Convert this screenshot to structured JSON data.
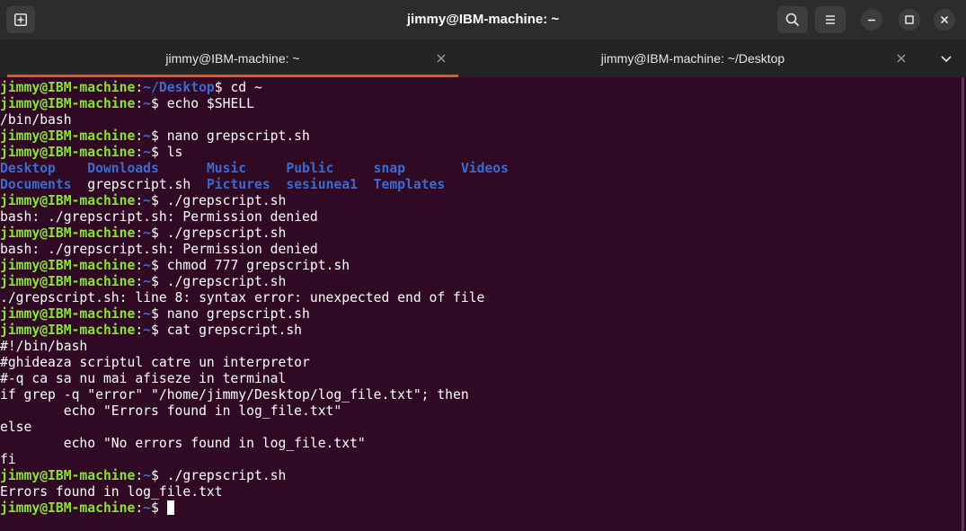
{
  "window": {
    "title": "jimmy@IBM-machine: ~"
  },
  "tabs": [
    {
      "label": "jimmy@IBM-machine: ~",
      "active": true
    },
    {
      "label": "jimmy@IBM-machine: ~/Desktop",
      "active": false
    }
  ],
  "icons": {
    "new_tab": "new-tab-icon",
    "search": "search-icon",
    "menu": "hamburger-menu-icon",
    "minimize": "minimize-icon",
    "maximize": "maximize-icon",
    "close": "close-icon",
    "tab_close": "close-icon",
    "tabs_dropdown": "chevron-down-icon"
  },
  "colors": {
    "terminal_bg": "#300a24",
    "prompt_user": "#8ae234",
    "prompt_path": "#3b6bd1",
    "directory": "#3b6bd1",
    "text": "#ffffff",
    "active_tab_underline": "#e95420"
  },
  "prompt": {
    "user_host": "jimmy@IBM-machine",
    "separator": ":",
    "suffix": "$ "
  },
  "terminal": {
    "lines": [
      {
        "type": "prompt",
        "path": "~/Desktop",
        "cmd": "cd ~"
      },
      {
        "type": "prompt",
        "path": "~",
        "cmd": "echo $SHELL"
      },
      {
        "type": "output",
        "text": "/bin/bash"
      },
      {
        "type": "prompt",
        "path": "~",
        "cmd": "nano grepscript.sh"
      },
      {
        "type": "prompt",
        "path": "~",
        "cmd": "ls"
      },
      {
        "type": "ls",
        "cells": [
          {
            "text": "Desktop   ",
            "dir": true
          },
          {
            "text": " ",
            "dir": false
          },
          {
            "text": "Downloads ",
            "dir": true
          },
          {
            "text": "     ",
            "dir": false
          },
          {
            "text": "Music",
            "dir": true
          },
          {
            "text": "     ",
            "dir": false
          },
          {
            "text": "Public",
            "dir": true
          },
          {
            "text": "     ",
            "dir": false
          },
          {
            "text": "snap",
            "dir": true
          },
          {
            "text": "       ",
            "dir": false
          },
          {
            "text": "Videos",
            "dir": true
          }
        ]
      },
      {
        "type": "ls",
        "cells": [
          {
            "text": "Documents",
            "dir": true
          },
          {
            "text": "  ",
            "dir": false
          },
          {
            "text": "grepscript.sh",
            "dir": false
          },
          {
            "text": "  ",
            "dir": false
          },
          {
            "text": "Pictures",
            "dir": true
          },
          {
            "text": "  ",
            "dir": false
          },
          {
            "text": "sesiunea1",
            "dir": true
          },
          {
            "text": "  ",
            "dir": false
          },
          {
            "text": "Templates",
            "dir": true
          }
        ]
      },
      {
        "type": "prompt",
        "path": "~",
        "cmd": "./grepscript.sh"
      },
      {
        "type": "output",
        "text": "bash: ./grepscript.sh: Permission denied"
      },
      {
        "type": "prompt",
        "path": "~",
        "cmd": "./grepscript.sh"
      },
      {
        "type": "output",
        "text": "bash: ./grepscript.sh: Permission denied"
      },
      {
        "type": "prompt",
        "path": "~",
        "cmd": "chmod 777 grepscript.sh"
      },
      {
        "type": "prompt",
        "path": "~",
        "cmd": "./grepscript.sh"
      },
      {
        "type": "output",
        "text": "./grepscript.sh: line 8: syntax error: unexpected end of file"
      },
      {
        "type": "prompt",
        "path": "~",
        "cmd": "nano grepscript.sh"
      },
      {
        "type": "prompt",
        "path": "~",
        "cmd": "cat grepscript.sh"
      },
      {
        "type": "output",
        "text": "#!/bin/bash"
      },
      {
        "type": "output",
        "text": "#ghideaza scriptul catre un interpretor"
      },
      {
        "type": "output",
        "text": "#-q ca sa nu mai afiseze in terminal"
      },
      {
        "type": "output",
        "text": "if grep -q \"error\" \"/home/jimmy/Desktop/log_file.txt\"; then"
      },
      {
        "type": "output",
        "text": "        echo \"Errors found in log_file.txt\""
      },
      {
        "type": "output",
        "text": "else"
      },
      {
        "type": "output",
        "text": "        echo \"No errors found in log_file.txt\""
      },
      {
        "type": "output",
        "text": "fi"
      },
      {
        "type": "prompt",
        "path": "~",
        "cmd": "./grepscript.sh"
      },
      {
        "type": "output",
        "text": "Errors found in log_file.txt"
      },
      {
        "type": "prompt",
        "path": "~",
        "cmd": "",
        "cursor": true
      }
    ]
  }
}
